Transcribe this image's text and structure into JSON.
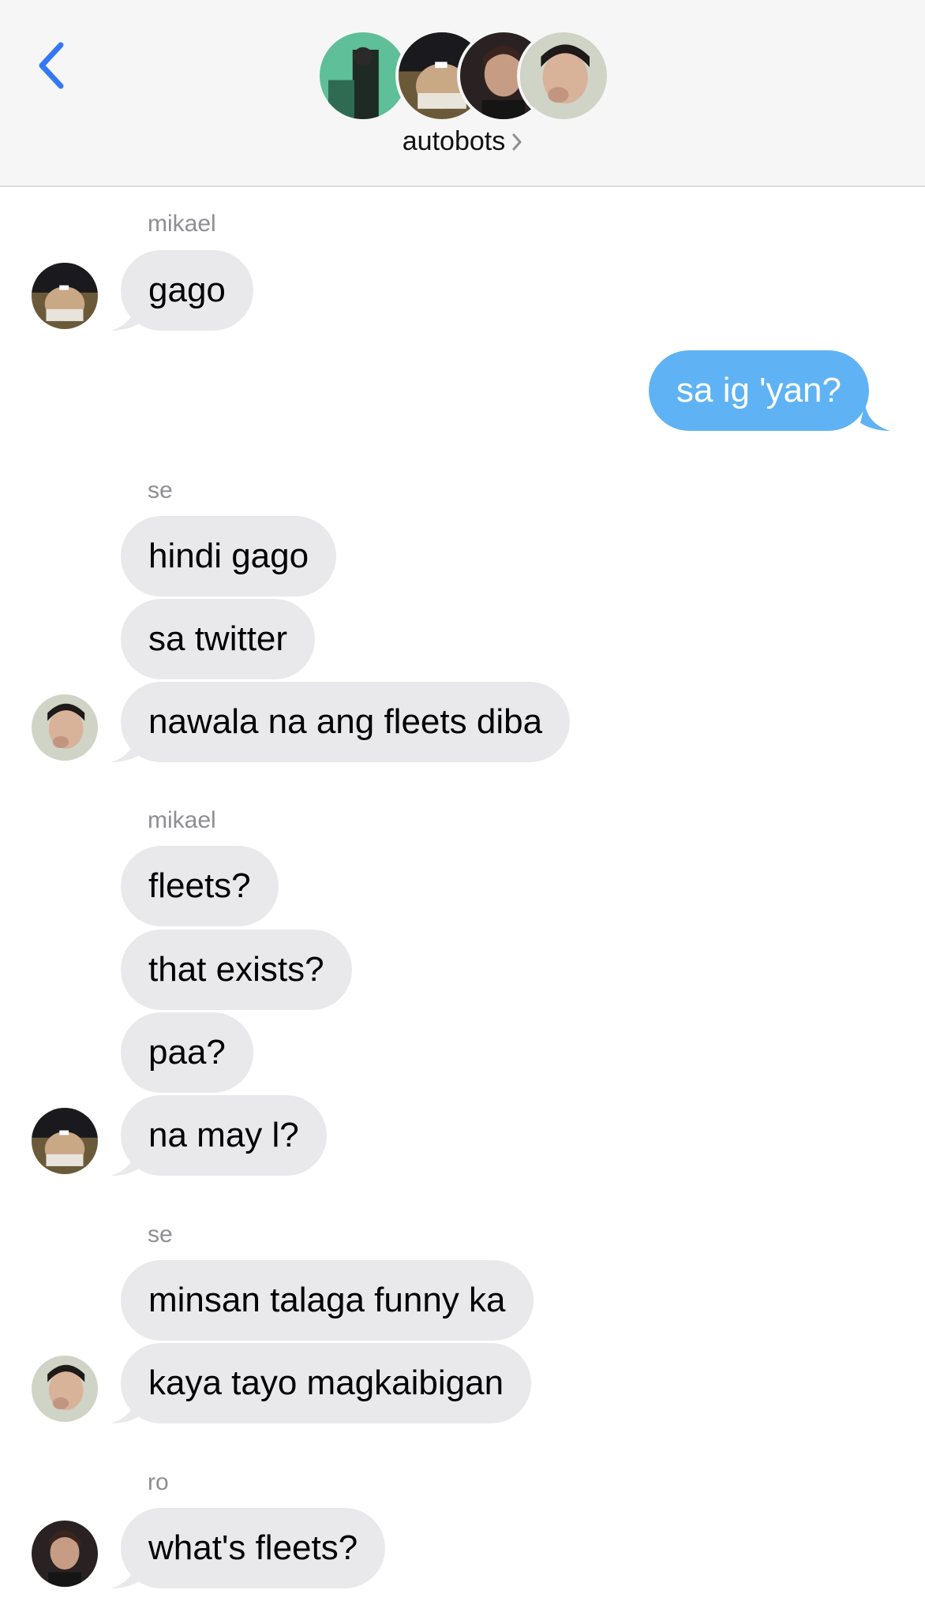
{
  "header": {
    "back_icon": "chevron-left-icon",
    "group_name": "autobots",
    "accent_color": "#3478f6"
  },
  "messages": [
    {
      "sender": "mikael",
      "text": "gago"
    },
    {
      "sender": "me",
      "text": "sa ig 'yan?"
    },
    {
      "sender": "se",
      "text": "hindi gago"
    },
    {
      "sender": "se",
      "text": "sa twitter"
    },
    {
      "sender": "se",
      "text": "nawala na ang fleets diba"
    },
    {
      "sender": "mikael",
      "text": "fleets?"
    },
    {
      "sender": "mikael",
      "text": "that exists?"
    },
    {
      "sender": "mikael",
      "text": "paa?"
    },
    {
      "sender": "mikael",
      "text": "na may l?"
    },
    {
      "sender": "se",
      "text": "minsan talaga funny ka"
    },
    {
      "sender": "se",
      "text": "kaya tayo magkaibigan"
    },
    {
      "sender": "ro",
      "text": "what's fleets?"
    }
  ],
  "sender_labels": [
    "mikael",
    "se",
    "mikael",
    "se",
    "ro"
  ],
  "colors": {
    "incoming_bubble": "#e9e9eb",
    "outgoing_bubble": "#5fb3f4",
    "sender_label": "#8e8e93"
  }
}
